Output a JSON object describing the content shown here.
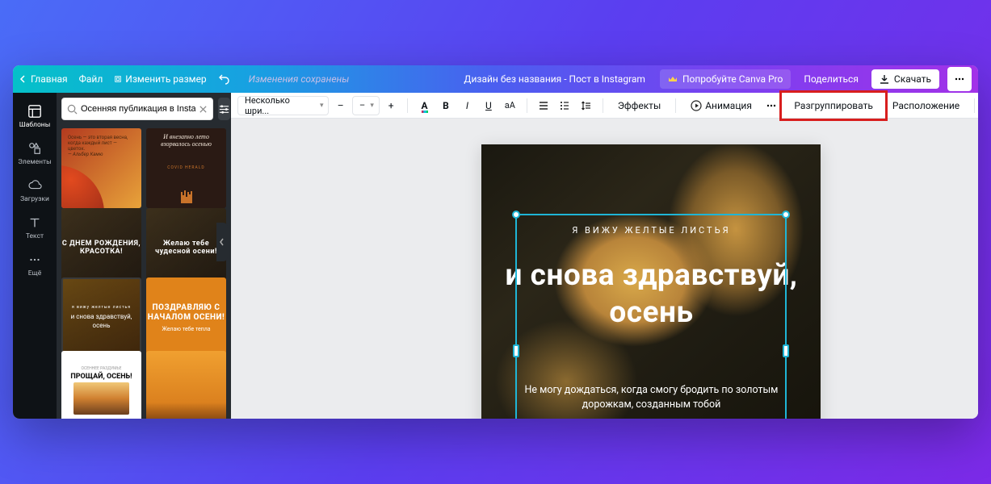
{
  "topbar": {
    "home": "Главная",
    "file": "Файл",
    "resize": "Изменить размер",
    "status": "Изменения сохранены",
    "doc_title": "Дизайн без названия - Пост в Instagram",
    "try_pro": "Попробуйте Canva Pro",
    "share": "Поделиться",
    "download": "Скачать"
  },
  "siderail": {
    "templates": "Шаблоны",
    "elements": "Элементы",
    "uploads": "Загрузки",
    "text": "Текст",
    "more": "Ещё"
  },
  "search": {
    "value": "Осенняя публикация в Instagram"
  },
  "templates": {
    "t1": "Осень — это вторая весна, когда каждый лист — цветок.",
    "t1_author": "— Альбер Камю",
    "t2": "И внезапно лето взорвалось осенью",
    "t3": "С ДНЕМ РОЖДЕНИЯ, КРАСОТКА!",
    "t4": "Желаю тебе чудесной осени!",
    "t5_top": "я вижу желтые листья",
    "t5_main": "и снова здравствуй, осень",
    "t6_main": "ПОЗДРАВЛЯЮ С НАЧАЛОМ ОСЕНИ!",
    "t6_sub": "Желаю тебе тепла",
    "t7": "ПРОЩАЙ, ОСЕНЬ!",
    "t8": ""
  },
  "toolbar": {
    "font": "Несколько шри...",
    "size": "–",
    "effects": "Эффекты",
    "animation": "Анимация",
    "ungroup": "Разгруппировать",
    "position": "Расположение"
  },
  "design": {
    "subtitle": "Я ВИЖУ ЖЕЛТЫЕ ЛИСТЬЯ",
    "headline": "и снова здравствуй, осень",
    "body": "Не могу дождаться, когда смогу бродить по золотым дорожкам, созданным тобой"
  }
}
